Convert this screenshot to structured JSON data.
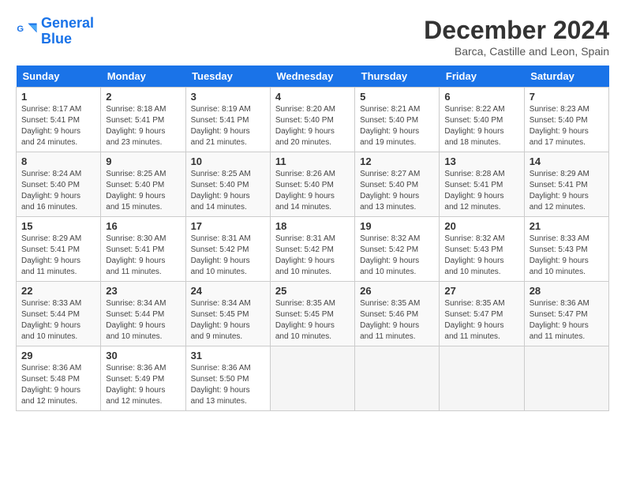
{
  "header": {
    "logo_line1": "General",
    "logo_line2": "Blue",
    "month_title": "December 2024",
    "subtitle": "Barca, Castille and Leon, Spain"
  },
  "days_of_week": [
    "Sunday",
    "Monday",
    "Tuesday",
    "Wednesday",
    "Thursday",
    "Friday",
    "Saturday"
  ],
  "weeks": [
    [
      {
        "day": "1",
        "sunrise": "Sunrise: 8:17 AM",
        "sunset": "Sunset: 5:41 PM",
        "daylight": "Daylight: 9 hours and 24 minutes."
      },
      {
        "day": "2",
        "sunrise": "Sunrise: 8:18 AM",
        "sunset": "Sunset: 5:41 PM",
        "daylight": "Daylight: 9 hours and 23 minutes."
      },
      {
        "day": "3",
        "sunrise": "Sunrise: 8:19 AM",
        "sunset": "Sunset: 5:41 PM",
        "daylight": "Daylight: 9 hours and 21 minutes."
      },
      {
        "day": "4",
        "sunrise": "Sunrise: 8:20 AM",
        "sunset": "Sunset: 5:40 PM",
        "daylight": "Daylight: 9 hours and 20 minutes."
      },
      {
        "day": "5",
        "sunrise": "Sunrise: 8:21 AM",
        "sunset": "Sunset: 5:40 PM",
        "daylight": "Daylight: 9 hours and 19 minutes."
      },
      {
        "day": "6",
        "sunrise": "Sunrise: 8:22 AM",
        "sunset": "Sunset: 5:40 PM",
        "daylight": "Daylight: 9 hours and 18 minutes."
      },
      {
        "day": "7",
        "sunrise": "Sunrise: 8:23 AM",
        "sunset": "Sunset: 5:40 PM",
        "daylight": "Daylight: 9 hours and 17 minutes."
      }
    ],
    [
      {
        "day": "8",
        "sunrise": "Sunrise: 8:24 AM",
        "sunset": "Sunset: 5:40 PM",
        "daylight": "Daylight: 9 hours and 16 minutes."
      },
      {
        "day": "9",
        "sunrise": "Sunrise: 8:25 AM",
        "sunset": "Sunset: 5:40 PM",
        "daylight": "Daylight: 9 hours and 15 minutes."
      },
      {
        "day": "10",
        "sunrise": "Sunrise: 8:25 AM",
        "sunset": "Sunset: 5:40 PM",
        "daylight": "Daylight: 9 hours and 14 minutes."
      },
      {
        "day": "11",
        "sunrise": "Sunrise: 8:26 AM",
        "sunset": "Sunset: 5:40 PM",
        "daylight": "Daylight: 9 hours and 14 minutes."
      },
      {
        "day": "12",
        "sunrise": "Sunrise: 8:27 AM",
        "sunset": "Sunset: 5:40 PM",
        "daylight": "Daylight: 9 hours and 13 minutes."
      },
      {
        "day": "13",
        "sunrise": "Sunrise: 8:28 AM",
        "sunset": "Sunset: 5:41 PM",
        "daylight": "Daylight: 9 hours and 12 minutes."
      },
      {
        "day": "14",
        "sunrise": "Sunrise: 8:29 AM",
        "sunset": "Sunset: 5:41 PM",
        "daylight": "Daylight: 9 hours and 12 minutes."
      }
    ],
    [
      {
        "day": "15",
        "sunrise": "Sunrise: 8:29 AM",
        "sunset": "Sunset: 5:41 PM",
        "daylight": "Daylight: 9 hours and 11 minutes."
      },
      {
        "day": "16",
        "sunrise": "Sunrise: 8:30 AM",
        "sunset": "Sunset: 5:41 PM",
        "daylight": "Daylight: 9 hours and 11 minutes."
      },
      {
        "day": "17",
        "sunrise": "Sunrise: 8:31 AM",
        "sunset": "Sunset: 5:42 PM",
        "daylight": "Daylight: 9 hours and 10 minutes."
      },
      {
        "day": "18",
        "sunrise": "Sunrise: 8:31 AM",
        "sunset": "Sunset: 5:42 PM",
        "daylight": "Daylight: 9 hours and 10 minutes."
      },
      {
        "day": "19",
        "sunrise": "Sunrise: 8:32 AM",
        "sunset": "Sunset: 5:42 PM",
        "daylight": "Daylight: 9 hours and 10 minutes."
      },
      {
        "day": "20",
        "sunrise": "Sunrise: 8:32 AM",
        "sunset": "Sunset: 5:43 PM",
        "daylight": "Daylight: 9 hours and 10 minutes."
      },
      {
        "day": "21",
        "sunrise": "Sunrise: 8:33 AM",
        "sunset": "Sunset: 5:43 PM",
        "daylight": "Daylight: 9 hours and 10 minutes."
      }
    ],
    [
      {
        "day": "22",
        "sunrise": "Sunrise: 8:33 AM",
        "sunset": "Sunset: 5:44 PM",
        "daylight": "Daylight: 9 hours and 10 minutes."
      },
      {
        "day": "23",
        "sunrise": "Sunrise: 8:34 AM",
        "sunset": "Sunset: 5:44 PM",
        "daylight": "Daylight: 9 hours and 10 minutes."
      },
      {
        "day": "24",
        "sunrise": "Sunrise: 8:34 AM",
        "sunset": "Sunset: 5:45 PM",
        "daylight": "Daylight: 9 hours and 9 minutes."
      },
      {
        "day": "25",
        "sunrise": "Sunrise: 8:35 AM",
        "sunset": "Sunset: 5:45 PM",
        "daylight": "Daylight: 9 hours and 10 minutes."
      },
      {
        "day": "26",
        "sunrise": "Sunrise: 8:35 AM",
        "sunset": "Sunset: 5:46 PM",
        "daylight": "Daylight: 9 hours and 11 minutes."
      },
      {
        "day": "27",
        "sunrise": "Sunrise: 8:35 AM",
        "sunset": "Sunset: 5:47 PM",
        "daylight": "Daylight: 9 hours and 11 minutes."
      },
      {
        "day": "28",
        "sunrise": "Sunrise: 8:36 AM",
        "sunset": "Sunset: 5:47 PM",
        "daylight": "Daylight: 9 hours and 11 minutes."
      }
    ],
    [
      {
        "day": "29",
        "sunrise": "Sunrise: 8:36 AM",
        "sunset": "Sunset: 5:48 PM",
        "daylight": "Daylight: 9 hours and 12 minutes."
      },
      {
        "day": "30",
        "sunrise": "Sunrise: 8:36 AM",
        "sunset": "Sunset: 5:49 PM",
        "daylight": "Daylight: 9 hours and 12 minutes."
      },
      {
        "day": "31",
        "sunrise": "Sunrise: 8:36 AM",
        "sunset": "Sunset: 5:50 PM",
        "daylight": "Daylight: 9 hours and 13 minutes."
      },
      null,
      null,
      null,
      null
    ]
  ]
}
